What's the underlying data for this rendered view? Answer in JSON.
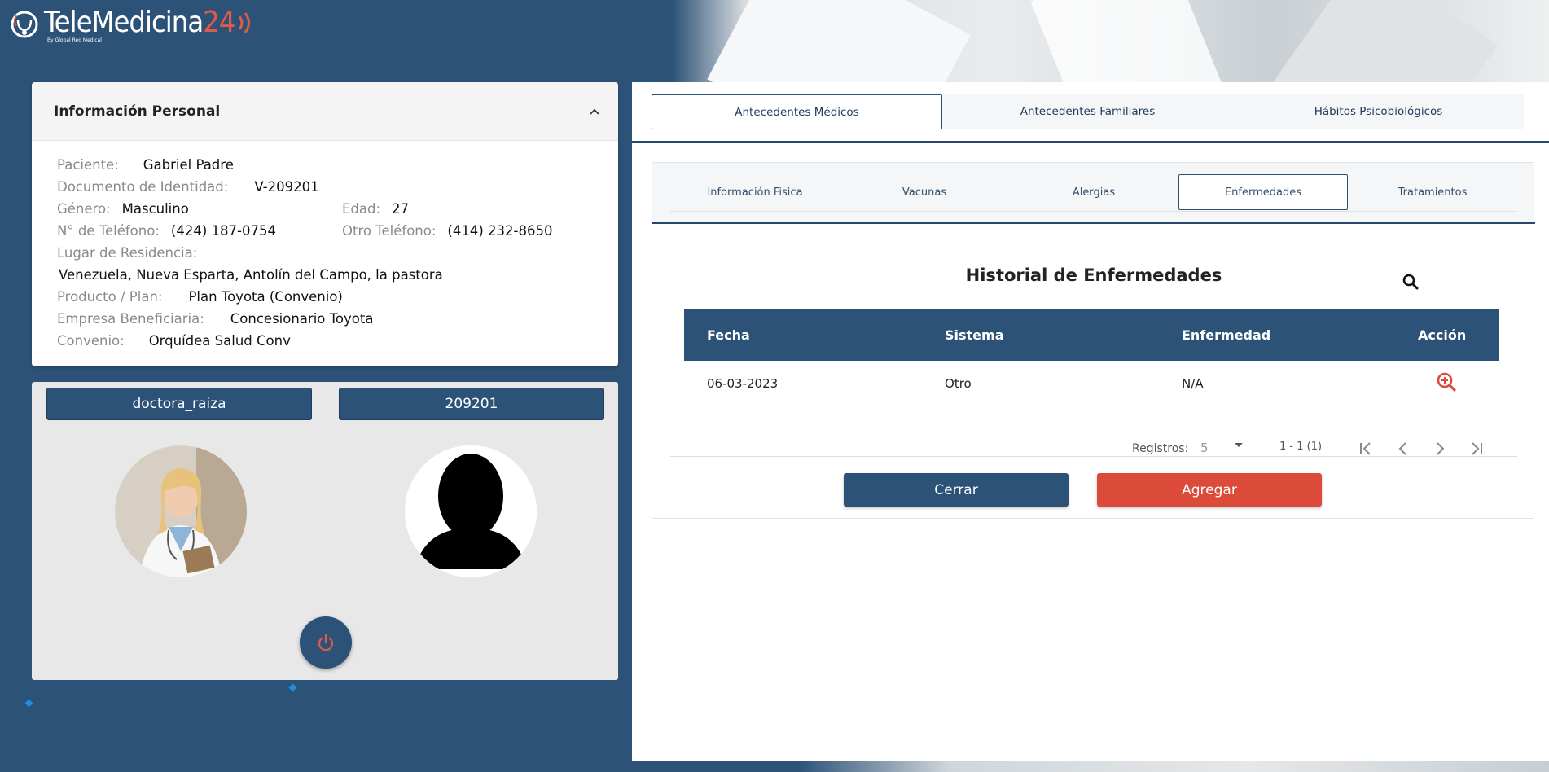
{
  "app": {
    "logo_text": "TeleMedicina",
    "logo_num": "24",
    "logo_sub": "By Global Red Medical"
  },
  "info": {
    "title": "Información Personal",
    "paciente_label": "Paciente:",
    "paciente": "Gabriel Padre",
    "documento_label": "Documento de Identidad:",
    "documento": "V-209201",
    "genero_label": "Género:",
    "genero": "Masculino",
    "edad_label": "Edad:",
    "edad": "27",
    "telefono_label": "N° de Teléfono:",
    "telefono": "(424) 187-0754",
    "otro_tel_label": "Otro Teléfono:",
    "otro_tel": "(414) 232-8650",
    "residencia_label": "Lugar de Residencia:",
    "residencia": "Venezuela, Nueva Esparta, Antolín del Campo, la pastora",
    "producto_label": "Producto / Plan:",
    "producto": "Plan Toyota (Convenio)",
    "empresa_label": "Empresa Beneficiaria:",
    "empresa": "Concesionario Toyota",
    "convenio_label": "Convenio:",
    "convenio": "Orquídea Salud Conv"
  },
  "video": {
    "doctor_name": "doctora_raiza",
    "patient_id": "209201"
  },
  "top_tabs": [
    "Antecedentes Médicos",
    "Antecedentes Familiares",
    "Hábitos Psicobiológicos"
  ],
  "sub_tabs": [
    "Información Fisica",
    "Vacunas",
    "Alergias",
    "Enfermedades",
    "Tratamientos"
  ],
  "section": {
    "title": "Historial de Enfermedades"
  },
  "table": {
    "headers": [
      "Fecha",
      "Sistema",
      "Enfermedad",
      "Acción"
    ],
    "rows": [
      {
        "fecha": "06-03-2023",
        "sistema": "Otro",
        "enfermedad": "N/A"
      }
    ]
  },
  "paginator": {
    "label": "Registros:",
    "page_size": "5",
    "range": "1 - 1 (1)"
  },
  "buttons": {
    "close": "Cerrar",
    "add": "Agregar"
  },
  "colors": {
    "primary": "#2c5278",
    "accent": "#dc4b39"
  }
}
